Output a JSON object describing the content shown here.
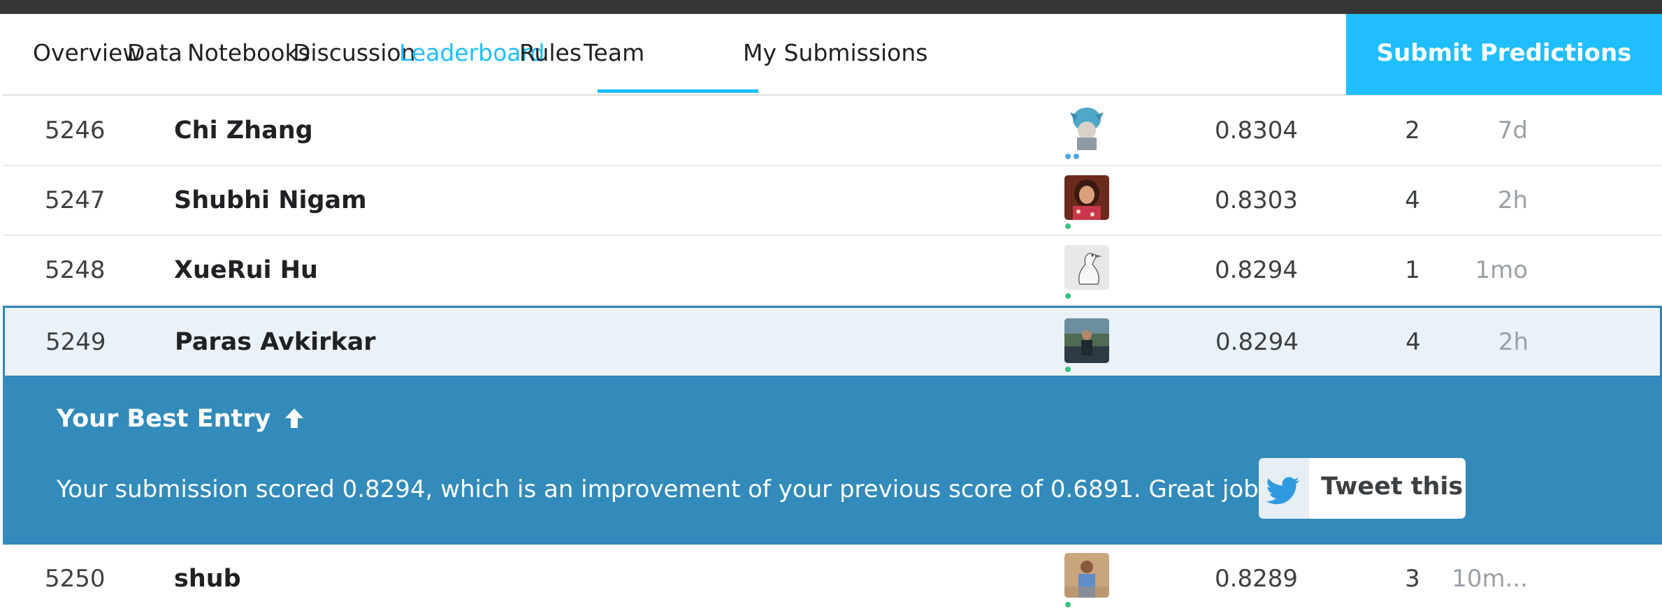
{
  "nav": {
    "tabs": [
      {
        "label": "Overview",
        "active": false
      },
      {
        "label": "Data",
        "active": false
      },
      {
        "label": "Notebooks",
        "active": false
      },
      {
        "label": "Discussion",
        "active": false
      },
      {
        "label": "Leaderboard",
        "active": true
      },
      {
        "label": "Rules",
        "active": false
      },
      {
        "label": "Team",
        "active": false
      }
    ],
    "my_submissions": "My Submissions",
    "submit_label": "Submit Predictions"
  },
  "leaderboard": {
    "rows": [
      {
        "rank": "5246",
        "name": "Chi Zhang",
        "score": "0.8304",
        "entries": "2",
        "last": "7d",
        "avatar": "anime-character-avatar",
        "status": "dual"
      },
      {
        "rank": "5247",
        "name": "Shubhi Nigam",
        "score": "0.8303",
        "entries": "4",
        "last": "2h",
        "avatar": "woman-photo-avatar",
        "status": "online"
      },
      {
        "rank": "5248",
        "name": "XueRui Hu",
        "score": "0.8294",
        "entries": "1",
        "last": "1mo",
        "avatar": "goose-sketch-avatar",
        "status": "online"
      },
      {
        "rank": "5249",
        "name": "Paras Avkirkar",
        "score": "0.8294",
        "entries": "4",
        "last": "2h",
        "avatar": "person-outdoor-photo-avatar",
        "status": "online"
      },
      {
        "rank": "5250",
        "name": "shub",
        "score": "0.8289",
        "entries": "3",
        "last": "10m...",
        "avatar": "man-shirt-photo-avatar",
        "status": "online"
      }
    ]
  },
  "best_entry": {
    "title": "Your Best Entry",
    "message": "Your submission scored 0.8294, which is an improvement of your previous score of 0.6891. Great job!",
    "tweet_label": "Tweet this!"
  },
  "colors": {
    "accent": "#20beff",
    "panel": "#328bba",
    "highlight_row": "#eaf2f8",
    "online_dot": "#34c47c"
  }
}
